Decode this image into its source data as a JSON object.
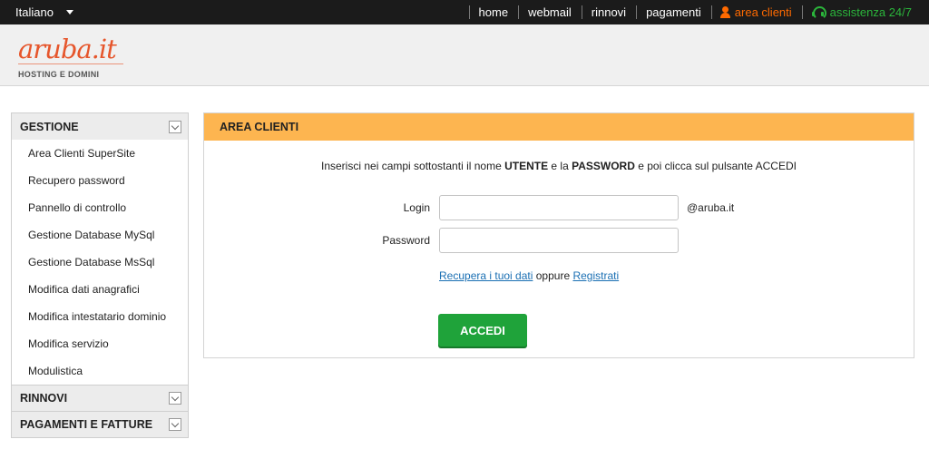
{
  "topbar": {
    "language": "Italiano",
    "nav": [
      "home",
      "webmail",
      "rinnovi",
      "pagamenti"
    ],
    "area_clienti": "area clienti",
    "assistenza": "assistenza 24/7",
    "colors": {
      "area": "#ff6a00",
      "assist": "#2bb53b"
    }
  },
  "header": {
    "logo_text": "aruba.it",
    "logo_sub": "HOSTING E DOMINI"
  },
  "sidebar": {
    "sections": {
      "gestione": "GESTIONE",
      "rinnovi": "RINNOVI",
      "pagamenti": "PAGAMENTI E FATTURE"
    },
    "items": [
      "Area Clienti SuperSite",
      "Recupero password",
      "Pannello di controllo",
      "Gestione Database MySql",
      "Gestione Database MsSql",
      "Modifica dati anagrafici",
      "Modifica intestatario dominio",
      "Modifica servizio",
      "Modulistica"
    ]
  },
  "panel": {
    "title": "AREA CLIENTI",
    "instr_1": "Inserisci nei campi sottostanti il nome ",
    "instr_user": "UTENTE",
    "instr_2": " e la ",
    "instr_pass": "PASSWORD",
    "instr_3": " e poi clicca sul pulsante ACCEDI",
    "login_label": "Login",
    "login_value": "",
    "login_suffix": "@aruba.it",
    "password_label": "Password",
    "password_value": "",
    "recover_link": "Recupera i tuoi dati",
    "or_text": "oppure",
    "register_link": "Registrati",
    "submit_label": "ACCEDI",
    "colors": {
      "header": "#fdb550",
      "button": "#1fa33a",
      "link": "#1a6fb3"
    }
  }
}
